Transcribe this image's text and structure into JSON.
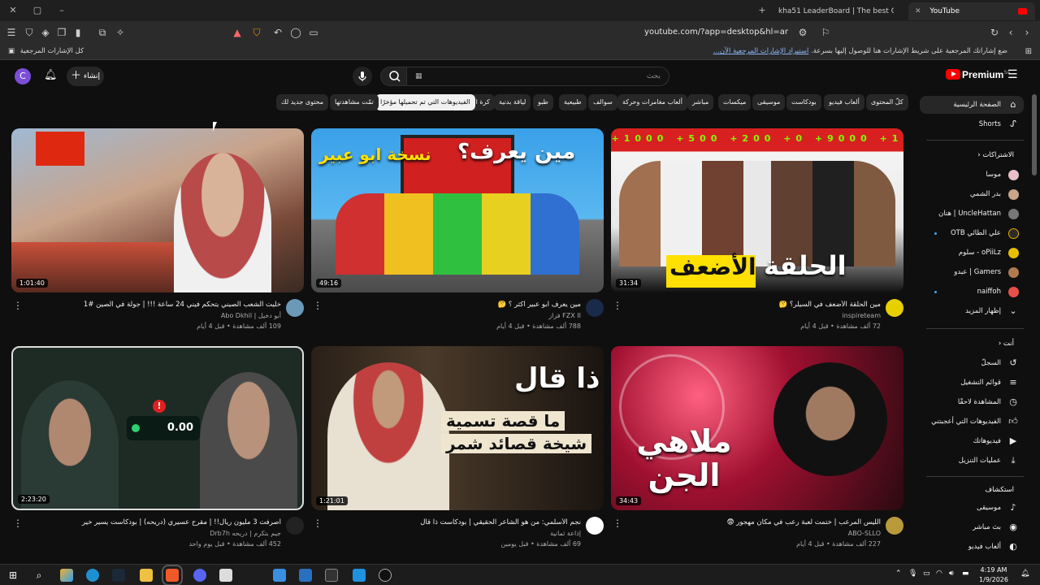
{
  "browser": {
    "tabs": [
      {
        "label": "kha51 LeaderBoard | The best ChatBo..."
      },
      {
        "label": "YouTube"
      }
    ],
    "url": "youtube.com/?app=desktop&hl=ar",
    "bookmarks_left": "كل الإشارات المرجعية",
    "bookmarks_hint": "ضع إشاراتك المرجعية على شريط الإشارات هنا للوصول إليها بسرعة.",
    "bookmarks_link": "استيراد الإشارات المرجعية الآن..."
  },
  "header": {
    "avatar_letter": "C",
    "create_label": "إنشاء",
    "search_placeholder": "بحث",
    "logo_text": "Premium",
    "logo_sup": "SA"
  },
  "chips": [
    "كلّ المحتوى",
    "ألعاب فيديو",
    "بودكاست",
    "موسيقى",
    "ميكسات",
    "مباشر",
    "ألعاب مغامرات وحركة",
    "سوالف",
    "طبيعية",
    "طبو",
    "لياقة بدنية",
    "كرة القدم",
    "الفيديوهات التي تم تحميلها مؤخرًا",
    "تمّت مشاهدتها",
    "محتوى جديد لك"
  ],
  "sidebar": {
    "home": "الصفحة الرئيسية",
    "shorts": "Shorts",
    "subs_header": "الاشتراكات",
    "subs": [
      "موسا",
      "بدر الشمي",
      "UncleHattan | هتان",
      "علي الطائي OTB",
      "oPiiLz - سلوم",
      "Gamers | عبدو",
      "naiffoh"
    ],
    "show_more": "إظهار المزيد",
    "you_header": "أنت",
    "you_items": [
      "السجلّ",
      "قوائم التشغيل",
      "المشاهدة لاحقًا",
      "الفيديوهات التي أعجبتني",
      "فيديوهاتك",
      "عمليات التنزيل"
    ],
    "explore_header": "استكشاف",
    "explore_items": [
      "موسيقى",
      "بث مباشر",
      "ألعاب فيديو"
    ]
  },
  "videos": [
    {
      "title": "خليت الشعب الصيني يتحكم فيني 24 ساعة !!! | جولة في الصين #1",
      "channel": "أبو دخيل | Abo Dkhil",
      "meta": "109 ألف مشاهدة • قبل 4 أيام",
      "duration": "1:01:40",
      "thumb_text": ""
    },
    {
      "title": "مين يعرف ابو عبير اكثر ؟ 🤔",
      "channel": "FZX II فزاز",
      "meta": "788 ألف مشاهدة • قبل 4 أيام",
      "duration": "49:16",
      "thumb_text": "مين يعرف؟ نسخة ابو عبير"
    },
    {
      "title": "مين الحلقة الأضعف في السيلر؟ 🤔",
      "channel": "inspireteam",
      "meta": "72 ألف مشاهدة • قبل 4 أيام",
      "duration": "31:34",
      "thumb_text": "الحلقة الأضعف"
    },
    {
      "title": "اصرفت 3 مليون ريال!! | مقرح عسيري (دريحه) | بودكاست يسير خير",
      "channel": "جيم بتكرم | دريحه Drb7h",
      "meta": "452 ألف مشاهدة • قبل يوم واحد",
      "duration": "2:23:20",
      "thumb_text": "0.00"
    },
    {
      "title": "نجم الأسلمي: من هو الشاعر الحقيقي | بودكاست ذا قال",
      "channel": "إذاعة ثمانية",
      "meta": "69 ألف مشاهدة • قبل يومين",
      "duration": "1:21:01",
      "thumb_text": "ذا قال ما قصة تسمية شيخة قصائد شمر"
    },
    {
      "title": "الليس المرعب | ختمت لعبة رعب في مكان مهجور 😨",
      "channel": "ABO-SLLO",
      "meta": "227 ألف مشاهدة • قبل 4 أيام",
      "duration": "34:43",
      "thumb_text": "ملاهي الجن"
    }
  ],
  "taskbar": {
    "time": "4:19 AM",
    "date": "1/9/2026"
  }
}
